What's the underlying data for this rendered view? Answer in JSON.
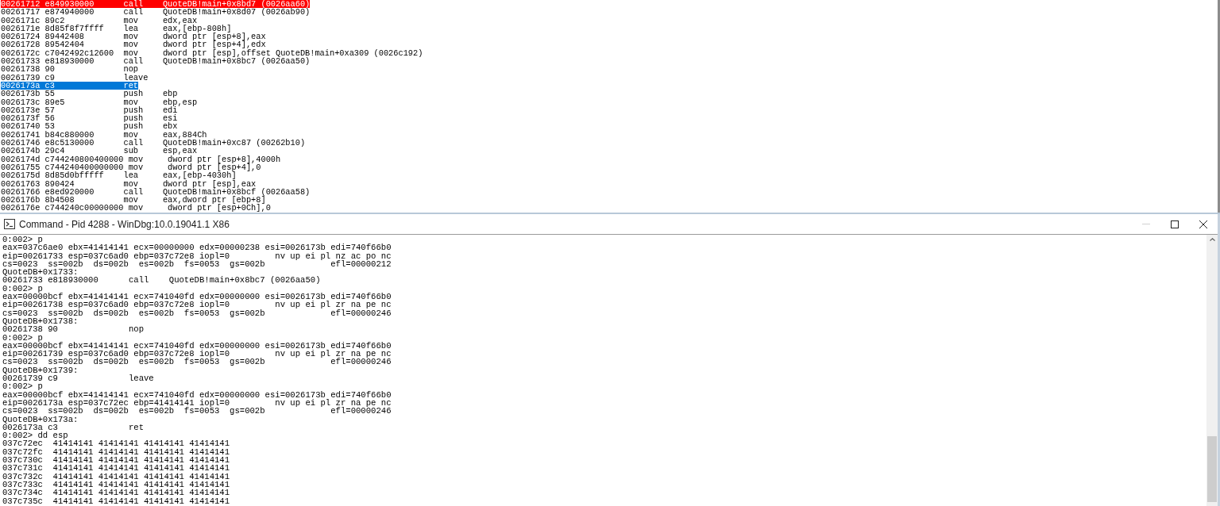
{
  "disassembly": {
    "rows": [
      {
        "address": "00261712",
        "bytes": "e849930000",
        "mnemonic": "call",
        "operands": "QuoteDB!main+0x8bd7 (0026aa60)",
        "breakpoint": true,
        "current": false
      },
      {
        "address": "00261717",
        "bytes": "e874940000",
        "mnemonic": "call",
        "operands": "QuoteDB!main+0x8d07 (0026ab90)",
        "breakpoint": false,
        "current": false
      },
      {
        "address": "0026171c",
        "bytes": "89c2",
        "mnemonic": "mov",
        "operands": "edx,eax",
        "breakpoint": false,
        "current": false
      },
      {
        "address": "0026171e",
        "bytes": "8d85f8f7ffff",
        "mnemonic": "lea",
        "operands": "eax,[ebp-808h]",
        "breakpoint": false,
        "current": false
      },
      {
        "address": "00261724",
        "bytes": "89442408",
        "mnemonic": "mov",
        "operands": "dword ptr [esp+8],eax",
        "breakpoint": false,
        "current": false
      },
      {
        "address": "00261728",
        "bytes": "89542404",
        "mnemonic": "mov",
        "operands": "dword ptr [esp+4],edx",
        "breakpoint": false,
        "current": false
      },
      {
        "address": "0026172c",
        "bytes": "c7042492c12600",
        "mnemonic": "mov",
        "operands": "dword ptr [esp],offset QuoteDB!main+0xa309 (0026c192)",
        "breakpoint": false,
        "current": false
      },
      {
        "address": "00261733",
        "bytes": "e818930000",
        "mnemonic": "call",
        "operands": "QuoteDB!main+0x8bc7 (0026aa50)",
        "breakpoint": false,
        "current": false
      },
      {
        "address": "00261738",
        "bytes": "90",
        "mnemonic": "nop",
        "breakpoint": false,
        "current": false
      },
      {
        "address": "00261739",
        "bytes": "c9",
        "mnemonic": "leave",
        "breakpoint": false,
        "current": false
      },
      {
        "address": "0026173a",
        "bytes": "c3",
        "mnemonic": "ret",
        "breakpoint": false,
        "current": true
      },
      {
        "address": "0026173b",
        "bytes": "55",
        "mnemonic": "push",
        "operands": "ebp",
        "breakpoint": false,
        "current": false
      },
      {
        "address": "0026173c",
        "bytes": "89e5",
        "mnemonic": "mov",
        "operands": "ebp,esp",
        "breakpoint": false,
        "current": false
      },
      {
        "address": "0026173e",
        "bytes": "57",
        "mnemonic": "push",
        "operands": "edi",
        "breakpoint": false,
        "current": false
      },
      {
        "address": "0026173f",
        "bytes": "56",
        "mnemonic": "push",
        "operands": "esi",
        "breakpoint": false,
        "current": false
      },
      {
        "address": "00261740",
        "bytes": "53",
        "mnemonic": "push",
        "operands": "ebx",
        "breakpoint": false,
        "current": false
      },
      {
        "address": "00261741",
        "bytes": "b84c880000",
        "mnemonic": "mov",
        "operands": "eax,884Ch",
        "breakpoint": false,
        "current": false
      },
      {
        "address": "00261746",
        "bytes": "e8c5130000",
        "mnemonic": "call",
        "operands": "QuoteDB!main+0xc87 (00262b10)",
        "breakpoint": false,
        "current": false
      },
      {
        "address": "0026174b",
        "bytes": "29c4",
        "mnemonic": "sub",
        "operands": "esp,eax",
        "breakpoint": false,
        "current": false
      },
      {
        "address": "0026174d",
        "bytes": "c744240800400000",
        "mnemonic": "mov",
        "operands": "dword ptr [esp+8],4000h",
        "breakpoint": false,
        "current": false
      },
      {
        "address": "00261755",
        "bytes": "c744240400000000",
        "mnemonic": "mov",
        "operands": "dword ptr [esp+4],0",
        "breakpoint": false,
        "current": false
      },
      {
        "address": "0026175d",
        "bytes": "8d85d0bfffff",
        "mnemonic": "lea",
        "operands": "eax,[ebp-4030h]",
        "breakpoint": false,
        "current": false
      },
      {
        "address": "00261763",
        "bytes": "890424",
        "mnemonic": "mov",
        "operands": "dword ptr [esp],eax",
        "breakpoint": false,
        "current": false
      },
      {
        "address": "00261766",
        "bytes": "e8ed920000",
        "mnemonic": "call",
        "operands": "QuoteDB!main+0x8bcf (0026aa58)",
        "breakpoint": false,
        "current": false
      },
      {
        "address": "0026176b",
        "bytes": "8b4508",
        "mnemonic": "mov",
        "operands": "eax,dword ptr [ebp+8]",
        "breakpoint": false,
        "current": false
      },
      {
        "address": "0026176e",
        "bytes": "c744240c00000000",
        "mnemonic": "mov",
        "operands": "dword ptr [esp+0Ch],0",
        "breakpoint": false,
        "current": false
      }
    ]
  },
  "command_window": {
    "title": "Command - Pid 4288 - WinDbg:10.0.19041.1 X86",
    "window_buttons": [
      {
        "kind": "minimize",
        "disabled": true
      },
      {
        "kind": "maximize",
        "disabled": false
      },
      {
        "kind": "close",
        "disabled": false
      }
    ],
    "output": [
      "0:002> p",
      "eax=037c6ae0 ebx=41414141 ecx=00000000 edx=00000238 esi=0026173b edi=740f66b0",
      "eip=00261733 esp=037c6ad0 ebp=037c72e8 iopl=0         nv up ei pl nz ac po nc",
      "cs=0023  ss=002b  ds=002b  es=002b  fs=0053  gs=002b             efl=00000212",
      "QuoteDB+0x1733:",
      "00261733 e818930000      call    QuoteDB!main+0x8bc7 (0026aa50)",
      "0:002> p",
      "eax=00000bcf ebx=41414141 ecx=741040fd edx=00000000 esi=0026173b edi=740f66b0",
      "eip=00261738 esp=037c6ad0 ebp=037c72e8 iopl=0         nv up ei pl zr na pe nc",
      "cs=0023  ss=002b  ds=002b  es=002b  fs=0053  gs=002b             efl=00000246",
      "QuoteDB+0x1738:",
      "00261738 90              nop",
      "0:002> p",
      "eax=00000bcf ebx=41414141 ecx=741040fd edx=00000000 esi=0026173b edi=740f66b0",
      "eip=00261739 esp=037c6ad0 ebp=037c72e8 iopl=0         nv up ei pl zr na pe nc",
      "cs=0023  ss=002b  ds=002b  es=002b  fs=0053  gs=002b             efl=00000246",
      "QuoteDB+0x1739:",
      "00261739 c9              leave",
      "0:002> p",
      "eax=00000bcf ebx=41414141 ecx=741040fd edx=00000000 esi=0026173b edi=740f66b0",
      "eip=0026173a esp=037c72ec ebp=41414141 iopl=0         nv up ei pl zr na pe nc",
      "cs=0023  ss=002b  ds=002b  es=002b  fs=0053  gs=002b             efl=00000246",
      "QuoteDB+0x173a:",
      "0026173a c3              ret",
      "0:002> dd esp",
      "037c72ec  41414141 41414141 41414141 41414141",
      "037c72fc  41414141 41414141 41414141 41414141",
      "037c730c  41414141 41414141 41414141 41414141",
      "037c731c  41414141 41414141 41414141 41414141",
      "037c732c  41414141 41414141 41414141 41414141",
      "037c733c  41414141 41414141 41414141 41414141",
      "037c734c  41414141 41414141 41414141 41414141",
      "037c735c  41414141 41414141 41414141 41414141"
    ]
  }
}
